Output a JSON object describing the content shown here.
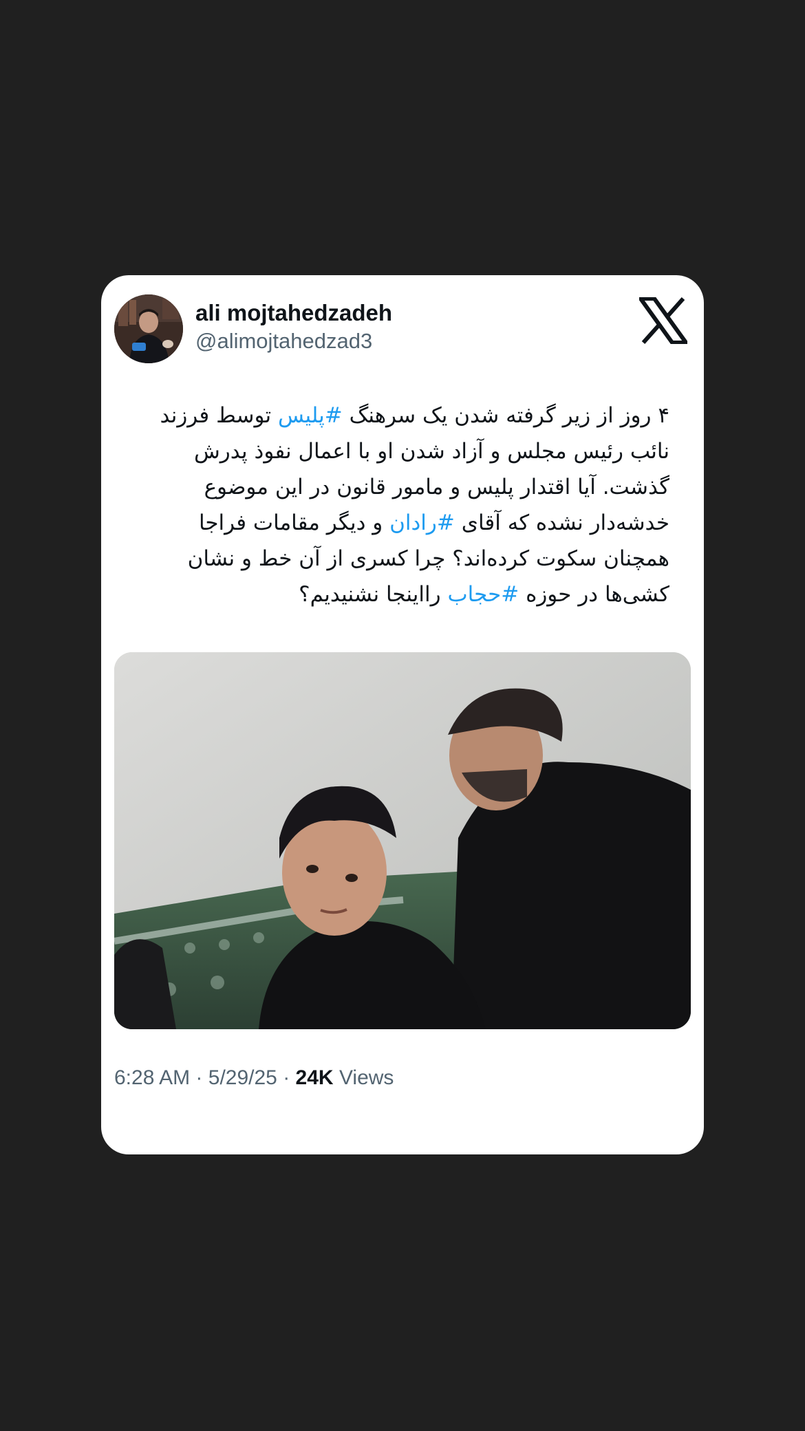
{
  "author": {
    "name": "ali mojtahedzadeh",
    "handle": "@alimojtahedzad3"
  },
  "tweet": {
    "text_segments": [
      {
        "text": "۴ روز از زیر گرفته شدن یک سرهنگ ",
        "hashtag": false
      },
      {
        "text": "#پلیس",
        "hashtag": true
      },
      {
        "text": " توسط فرزند نائب رئیس مجلس و آزاد شدن او با اعمال نفوذ پدرش گذشت. آیا اقتدار پلیس و مامور قانون در این موضوع خدشه‌دار نشده که آقای ",
        "hashtag": false
      },
      {
        "text": "#رادان",
        "hashtag": true
      },
      {
        "text": " و دیگر مقامات فراجا همچنان سکوت کرده‌اند؟ چرا کسری از آن خط و نشان کشی‌ها در حوزه ",
        "hashtag": false
      },
      {
        "text": "#حجاب",
        "hashtag": true
      },
      {
        "text": " رااینجا نشنیدیم؟",
        "hashtag": false
      }
    ]
  },
  "meta": {
    "time": "6:28 AM",
    "date": "5/29/25",
    "separator": "·",
    "views_count": "24K",
    "views_label": "Views"
  },
  "icons": {
    "platform": "x-logo-icon"
  },
  "colors": {
    "background": "#202020",
    "card": "#ffffff",
    "text": "#0f1419",
    "muted": "#536471",
    "hashtag": "#1d9bf0"
  }
}
